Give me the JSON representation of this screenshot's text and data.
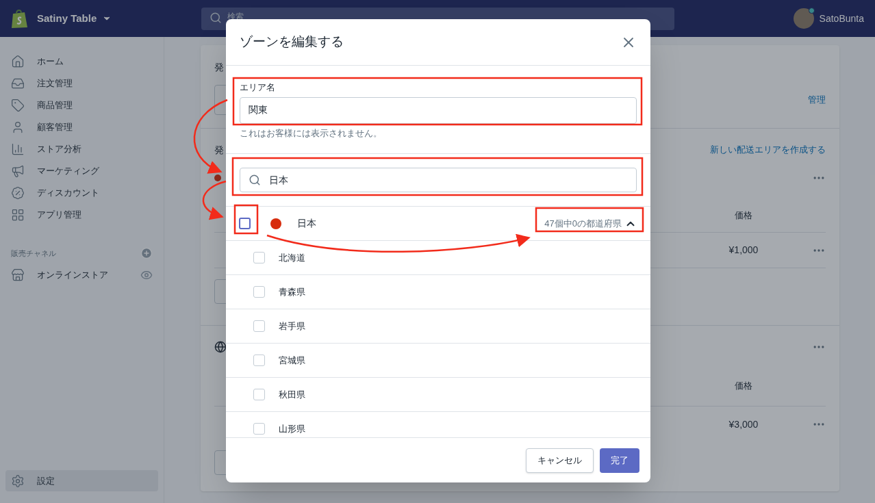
{
  "topbar": {
    "store_name": "Satiny Table",
    "search": {
      "placeholder": "検索"
    },
    "user_name": "SatoBunta"
  },
  "sidebar": {
    "items": [
      {
        "label": "ホーム",
        "selected": false
      },
      {
        "label": "注文管理",
        "selected": false
      },
      {
        "label": "商品管理",
        "selected": false
      },
      {
        "label": "顧客管理",
        "selected": false
      },
      {
        "label": "ストア分析",
        "selected": false
      },
      {
        "label": "マーケティング",
        "selected": false
      },
      {
        "label": "ディスカウント",
        "selected": false
      },
      {
        "label": "アプリ管理",
        "selected": false
      }
    ],
    "sales_channels": {
      "heading": "販売チャネル",
      "items": [
        {
          "label": "オンラインストア"
        }
      ]
    },
    "footer_item": {
      "label": "設定",
      "selected": true
    }
  },
  "card": {
    "sections": [
      {
        "title": "発",
        "action": "管理"
      },
      {
        "title": "発",
        "action": "新しい配送エリアを作成する",
        "column_header": "価格",
        "rates": [
          {
            "price": "¥1,000"
          }
        ]
      },
      {
        "column_header": "価格",
        "rates": [
          {
            "price": "¥3,000"
          }
        ]
      }
    ]
  },
  "modal": {
    "title": "ゾーンを編集する",
    "area_name": {
      "label": "エリア名",
      "value": "関東",
      "help": "これはお客様には表示されません。"
    },
    "search": {
      "value": "日本"
    },
    "country": {
      "name": "日本",
      "checked": false,
      "expanded": true,
      "color": "#d72c0d",
      "count": "47個中0の都道府県"
    },
    "regions": [
      {
        "name": "北海道",
        "checked": false
      },
      {
        "name": "青森県",
        "checked": false
      },
      {
        "name": "岩手県",
        "checked": false
      },
      {
        "name": "宮城県",
        "checked": false
      },
      {
        "name": "秋田県",
        "checked": false
      },
      {
        "name": "山形県",
        "checked": false
      }
    ],
    "buttons": {
      "cancel": "キャンセル",
      "done": "完了"
    }
  }
}
